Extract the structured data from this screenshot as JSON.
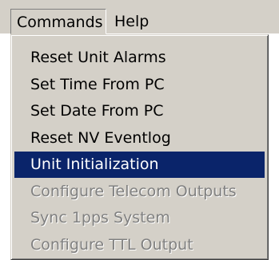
{
  "menubar": {
    "items": [
      {
        "label": "Commands",
        "state": "open"
      },
      {
        "label": "Help",
        "state": "normal"
      }
    ]
  },
  "commands_menu": {
    "items": [
      {
        "label": "Reset Unit Alarms",
        "enabled": true,
        "highlighted": false
      },
      {
        "label": "Set Time From PC",
        "enabled": true,
        "highlighted": false
      },
      {
        "label": "Set Date From PC",
        "enabled": true,
        "highlighted": false
      },
      {
        "label": "Reset NV Eventlog",
        "enabled": true,
        "highlighted": false
      },
      {
        "label": "Unit Initialization",
        "enabled": true,
        "highlighted": true
      },
      {
        "label": "Configure Telecom Outputs",
        "enabled": false,
        "highlighted": false
      },
      {
        "label": "Sync 1pps System",
        "enabled": false,
        "highlighted": false
      },
      {
        "label": "Configure TTL Output",
        "enabled": false,
        "highlighted": false
      }
    ]
  },
  "colors": {
    "menu_background": "#d4d0c8",
    "highlight_background": "#0a246a",
    "highlight_text": "#ffffff",
    "disabled_text": "#808080"
  }
}
